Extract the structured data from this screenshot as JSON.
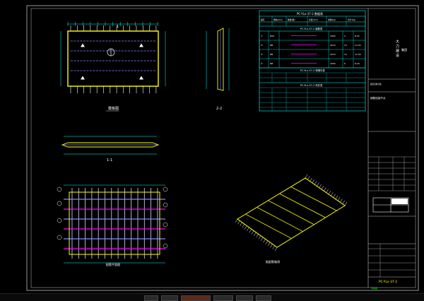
{
  "sheet": {
    "views": {
      "elevation_label": "模板图",
      "section_11_label": "1-1",
      "section_22_label": "2-2",
      "rebar_plan_label": "配筋平面图",
      "axon_label": "板配筋轴测"
    },
    "marker_11": "1",
    "marker_22": "2"
  },
  "tables": {
    "t1_title": "PC-YLx-37-2 数据表",
    "t1_header": [
      "编号",
      "规格(mm)",
      "数量(根)",
      "长度(mm)",
      "重量(kg)",
      "合计(kg)"
    ],
    "t1_subtitle": "PC-YLx-37-2 钢筋表",
    "rows": [
      {
        "mark": "①",
        "spec": "Φ10",
        "len": "3450",
        "count": "4",
        "wt": "8.52"
      },
      {
        "mark": "②",
        "spec": "Φ8",
        "len": "2210",
        "count": "14",
        "wt": "12.20"
      },
      {
        "mark": "③",
        "spec": "Φ8",
        "len": "2210",
        "count": "14",
        "wt": "12.20"
      },
      {
        "mark": "④",
        "spec": "Φ8",
        "len": "3450",
        "count": "6",
        "wt": "8.18"
      }
    ],
    "t2_title": "PC-YLx-37-2 预埋件表",
    "t3_title": "PC-YLx-37-2 吊件表"
  },
  "title_block": {
    "company": "大 力 建 设",
    "company_line2": "集团",
    "project": "装配式叠合板",
    "drawing_no": "PC-YLx-37-2",
    "note": "钢筋连接节点",
    "stamp": "专用章"
  },
  "taskbar": {
    "labels": [
      "",
      "",
      "",
      "",
      "",
      ""
    ]
  },
  "colors": {
    "outline": "#ffff00",
    "dim": "#00ffff",
    "rebar": "#ff00ff",
    "bar": "#8888ff",
    "text": "#ffffff",
    "frame": "#c0c0c0"
  }
}
